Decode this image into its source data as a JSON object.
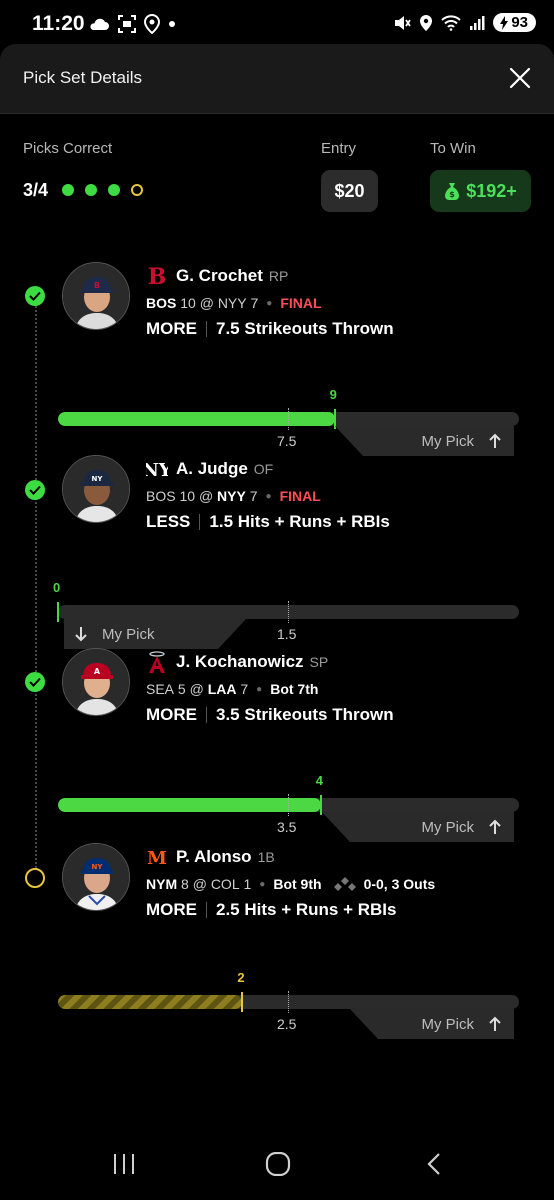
{
  "status_bar": {
    "time": "11:20",
    "battery": "93",
    "icons": [
      "cloud-icon",
      "screenshot-icon",
      "location-icon",
      "dot-icon",
      "mute-icon",
      "location-icon",
      "wifi-icon",
      "signal-icon",
      "battery-icon"
    ]
  },
  "sheet": {
    "title": "Pick Set Details"
  },
  "summary": {
    "picks_correct_label": "Picks Correct",
    "picks_correct_value": "3/4",
    "dots": [
      "correct",
      "correct",
      "correct",
      "pending"
    ],
    "entry_label": "Entry",
    "entry_value": "$20",
    "to_win_label": "To Win",
    "to_win_value": "$192+"
  },
  "picks": [
    {
      "name": "G. Crochet",
      "position": "RP",
      "team_logo": "red-sox-logo",
      "game": {
        "away": "BOS",
        "away_score": "10",
        "at": "@",
        "home": "NYY",
        "home_score": "7",
        "status": "FINAL",
        "bold_team": "away"
      },
      "direction": "MORE",
      "line": "7.5 Strikeouts Thrown",
      "line_value": "7.5",
      "result_value": "9",
      "progress": 0.6,
      "result": "correct",
      "my_pick_label": "My Pick",
      "my_pick_arrow": "up"
    },
    {
      "name": "A. Judge",
      "position": "OF",
      "team_logo": "yankees-logo",
      "game": {
        "away": "BOS",
        "away_score": "10",
        "at": "@",
        "home": "NYY",
        "home_score": "7",
        "status": "FINAL",
        "bold_team": "home"
      },
      "direction": "LESS",
      "line": "1.5 Hits + Runs + RBIs",
      "line_value": "1.5",
      "result_value": "0",
      "progress": 0.0,
      "result": "correct",
      "my_pick_label": "My Pick",
      "my_pick_arrow": "down"
    },
    {
      "name": "J. Kochanowicz",
      "position": "SP",
      "team_logo": "angels-logo",
      "game": {
        "away": "SEA",
        "away_score": "5",
        "at": "@",
        "home": "LAA",
        "home_score": "7",
        "status": "Bot 7th",
        "bold_team": "home"
      },
      "direction": "MORE",
      "line": "3.5 Strikeouts Thrown",
      "line_value": "3.5",
      "result_value": "4",
      "progress": 0.57,
      "result": "correct",
      "my_pick_label": "My Pick",
      "my_pick_arrow": "up"
    },
    {
      "name": "P. Alonso",
      "position": "1B",
      "team_logo": "mets-logo",
      "game": {
        "away": "NYM",
        "away_score": "8",
        "at": "@",
        "home": "COL",
        "home_score": "1",
        "status": "Bot 9th",
        "count": "0-0, 3 Outs",
        "bold_team": "away"
      },
      "direction": "MORE",
      "line": "2.5 Hits + Runs + RBIs",
      "line_value": "2.5",
      "result_value": "2",
      "progress": 0.4,
      "result": "pending",
      "my_pick_label": "My Pick",
      "my_pick_arrow": "up"
    }
  ],
  "colors": {
    "correct": "#3ddc42",
    "pending": "#e8c53a",
    "final": "#ff4d57",
    "win_bg": "#15391a"
  }
}
